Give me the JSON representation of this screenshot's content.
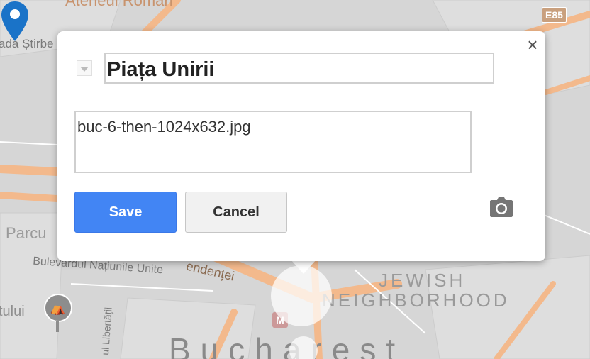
{
  "map": {
    "labels": {
      "ateneu": "Ateneul Român",
      "stirbe": "ada Știrbe",
      "parcu": "Parcu",
      "bulevardul": "Bulevardul Națiunile Unite",
      "independentei": "endenței",
      "tului": "tului",
      "libertatii": "ul Libertății",
      "jewish": "JEWISH",
      "neighborhood": "NEIGHBORHOOD",
      "bucharest": "Bucharest"
    },
    "shield": "E85",
    "metro": "M",
    "colors": {
      "road": "#f3b98c",
      "base": "#d6d6d6",
      "block": "#dcdcdc",
      "marker": "#1a73c8"
    }
  },
  "dialog": {
    "title_value": "Piața Unirii",
    "description_value": "buc-6-then-1024x632.jpg",
    "save_label": "Save",
    "cancel_label": "Cancel",
    "close_glyph": "×",
    "icons": [
      "close-icon",
      "camera-icon",
      "style-dropdown-icon",
      "map-marker-icon"
    ]
  }
}
